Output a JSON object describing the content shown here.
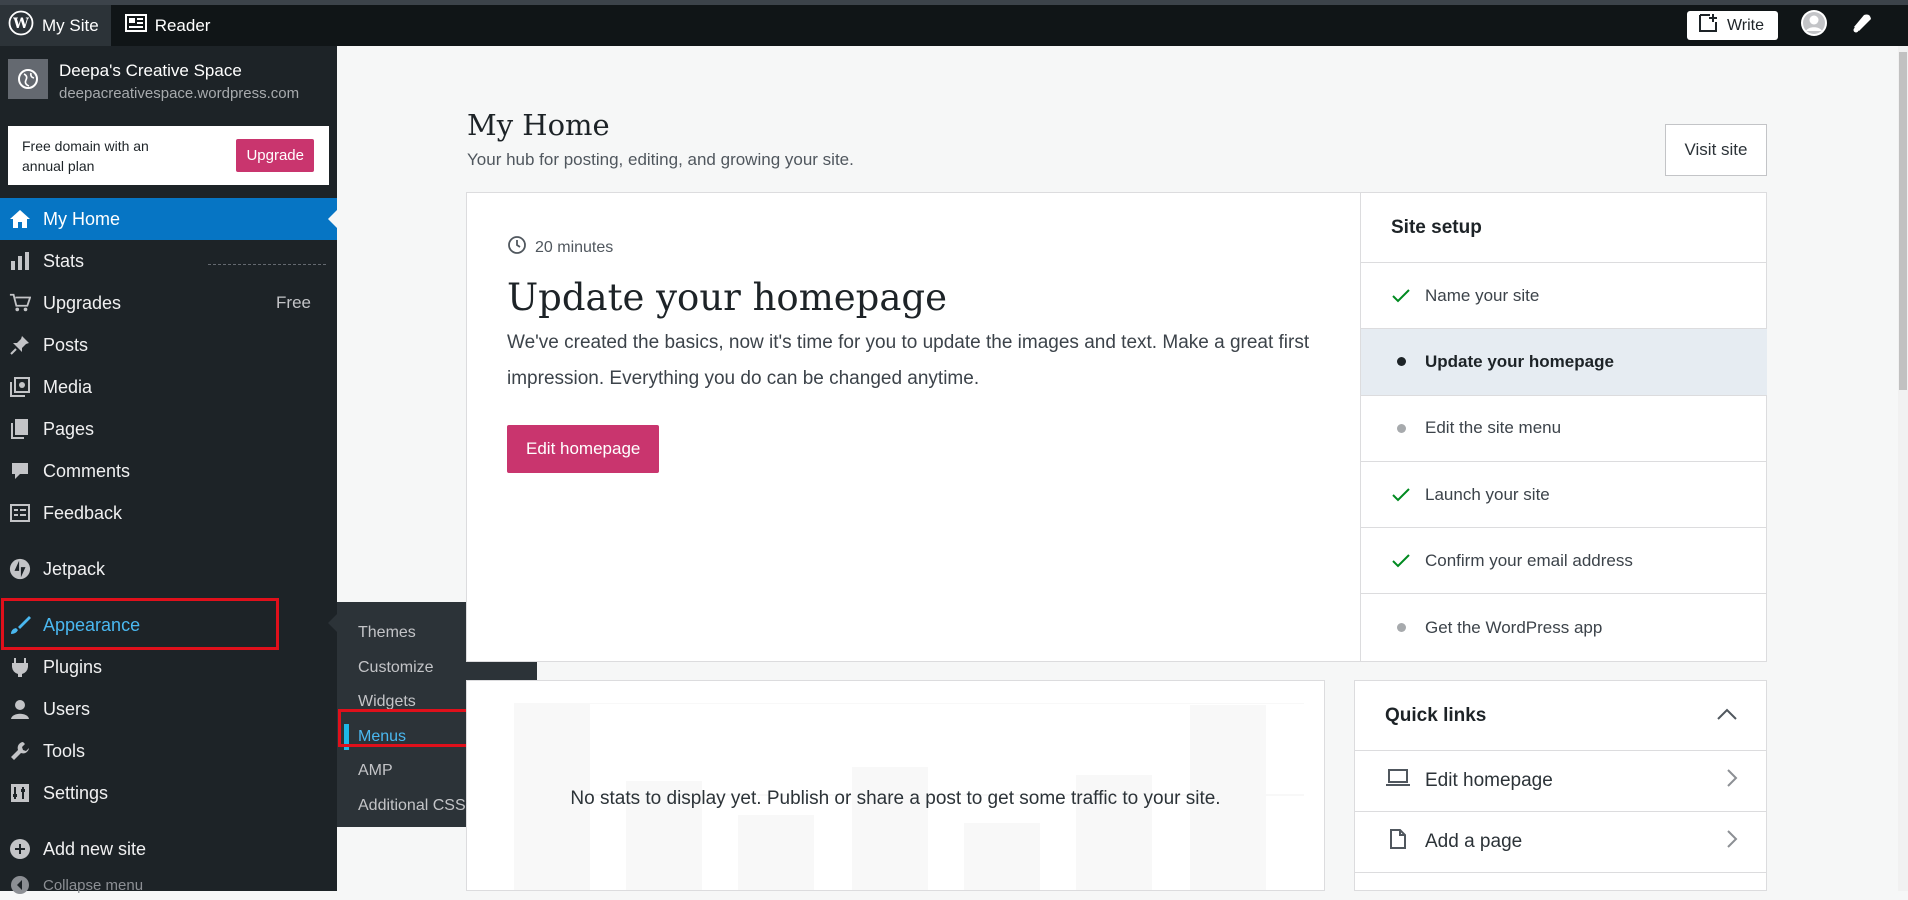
{
  "adminbar": {
    "my_site": "My Site",
    "reader": "Reader",
    "write": "Write"
  },
  "sidebar": {
    "site_name": "Deepa's Creative Space",
    "site_url": "deepacreativespace.wordpress.com",
    "upgrade_text": "Free domain with an annual plan",
    "upgrade_button": "Upgrade",
    "items": [
      {
        "label": "My Home",
        "icon": "home-icon"
      },
      {
        "label": "Stats",
        "icon": "stats-icon"
      },
      {
        "label": "Upgrades",
        "icon": "cart-icon",
        "badge": "Free"
      },
      {
        "label": "Posts",
        "icon": "pin-icon"
      },
      {
        "label": "Media",
        "icon": "media-icon"
      },
      {
        "label": "Pages",
        "icon": "pages-icon"
      },
      {
        "label": "Comments",
        "icon": "comment-icon"
      },
      {
        "label": "Feedback",
        "icon": "feedback-icon"
      },
      {
        "label": "Jetpack",
        "icon": "jetpack-icon"
      },
      {
        "label": "Appearance",
        "icon": "brush-icon"
      },
      {
        "label": "Plugins",
        "icon": "plug-icon"
      },
      {
        "label": "Users",
        "icon": "user-icon"
      },
      {
        "label": "Tools",
        "icon": "wrench-icon"
      },
      {
        "label": "Settings",
        "icon": "settings-icon"
      },
      {
        "label": "Add new site",
        "icon": "plus-circle-icon"
      },
      {
        "label": "Collapse menu",
        "icon": "collapse-icon"
      }
    ],
    "flyout": [
      "Themes",
      "Customize",
      "Widgets",
      "Menus",
      "AMP",
      "Additional CSS"
    ]
  },
  "main": {
    "title": "My Home",
    "subtitle": "Your hub for posting, editing, and growing your site.",
    "visit_site": "Visit site",
    "task": {
      "time": "20 minutes",
      "title": "Update your homepage",
      "description": "We've created the basics, now it's time for you to update the images and text. Make a great first impression. Everything you do can be changed anytime.",
      "button": "Edit homepage"
    },
    "setup": {
      "title": "Site setup",
      "items": [
        {
          "label": "Name your site",
          "state": "done"
        },
        {
          "label": "Update your homepage",
          "state": "current"
        },
        {
          "label": "Edit the site menu",
          "state": "todo"
        },
        {
          "label": "Launch your site",
          "state": "done"
        },
        {
          "label": "Confirm your email address",
          "state": "done"
        },
        {
          "label": "Get the WordPress app",
          "state": "todo"
        }
      ]
    },
    "stats_message": "No stats to display yet. Publish or share a post to get some traffic to your site.",
    "quick_links": {
      "title": "Quick links",
      "items": [
        {
          "label": "Edit homepage",
          "icon": "laptop-icon"
        },
        {
          "label": "Add a page",
          "icon": "page-icon"
        }
      ]
    }
  },
  "colors": {
    "accent": "#0675c4",
    "brand_pink": "#c9356e",
    "sidebar_bg": "#1d2327",
    "highlight_red": "#e0101b",
    "check_green": "#008a20"
  }
}
